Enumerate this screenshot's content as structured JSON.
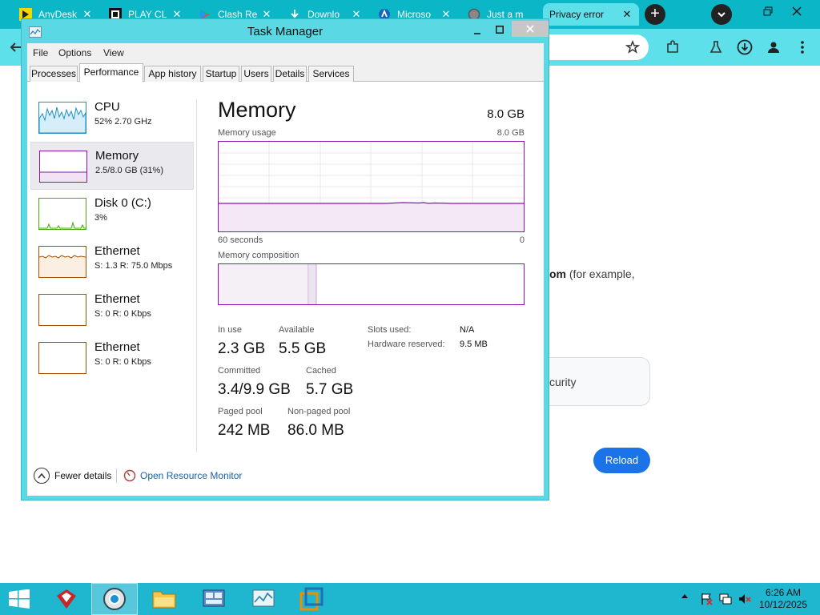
{
  "browser": {
    "tabs": [
      {
        "title": "AnyDesk",
        "icon": "anydesk-icon",
        "active": false
      },
      {
        "title": "PLAY CL",
        "icon": "play-cl-icon",
        "active": false
      },
      {
        "title": "Clash Re",
        "icon": "google-play-icon",
        "active": false
      },
      {
        "title": "Downlo",
        "icon": "download-icon",
        "active": false
      },
      {
        "title": "Microso",
        "icon": "microsoft-icon",
        "active": false
      },
      {
        "title": "Just a m",
        "icon": "globe-icon",
        "active": false
      },
      {
        "title": "Privacy error",
        "icon": "warning-icon",
        "active": true
      }
    ],
    "tab_close": "✕",
    "new_tab": "+",
    "page": {
      "error_text_bold": "om",
      "error_text_rest": " (for example,",
      "box_label": "curity",
      "reload_label": "Reload"
    }
  },
  "task_manager": {
    "title": "Task Manager",
    "menu": [
      "File",
      "Options",
      "View"
    ],
    "tabs": [
      "Processes",
      "Performance",
      "App history",
      "Startup",
      "Users",
      "Details",
      "Services"
    ],
    "active_tab": "Performance",
    "resources": [
      {
        "name": "CPU",
        "value": "52%  2.70 GHz",
        "color": "#1c8fc3"
      },
      {
        "name": "Memory",
        "value": "2.5/8.0 GB (31%)",
        "color": "#8b12ae",
        "selected": true
      },
      {
        "name": "Disk 0 (C:)",
        "value": "3%",
        "color": "#4da60c"
      },
      {
        "name": "Ethernet",
        "value": "S: 1.3  R: 75.0 Mbps",
        "color": "#a74f01"
      },
      {
        "name": "Ethernet",
        "value": "S: 0  R: 0 Kbps",
        "color": "#a74f01"
      },
      {
        "name": "Ethernet",
        "value": "S: 0  R: 0 Kbps",
        "color": "#a74f01"
      }
    ],
    "memory": {
      "title": "Memory",
      "total": "8.0 GB",
      "usage_label": "Memory usage",
      "usage_max": "8.0 GB",
      "time_left": "60 seconds",
      "time_right": "0",
      "composition_label": "Memory composition",
      "in_use_label": "In use",
      "in_use": "2.3 GB",
      "available_label": "Available",
      "available": "5.5 GB",
      "committed_label": "Committed",
      "committed": "3.4/9.9 GB",
      "cached_label": "Cached",
      "cached": "5.7 GB",
      "paged_label": "Paged pool",
      "paged": "242 MB",
      "nonpaged_label": "Non-paged pool",
      "nonpaged": "86.0 MB",
      "slots_label": "Slots used:",
      "slots": "N/A",
      "hw_label": "Hardware reserved:",
      "hw": "9.5 MB",
      "usage_fraction": 0.31
    },
    "footer": {
      "fewer_details": "Fewer details",
      "open_resource_monitor": "Open Resource Monitor"
    }
  },
  "taskbar": {
    "apps": [
      "ccleaner-icon",
      "browser-icon",
      "file-explorer-icon",
      "control-panel-icon",
      "task-manager-icon",
      "vmware-icon"
    ],
    "time": "6:26 AM",
    "date": "10/12/2025"
  }
}
